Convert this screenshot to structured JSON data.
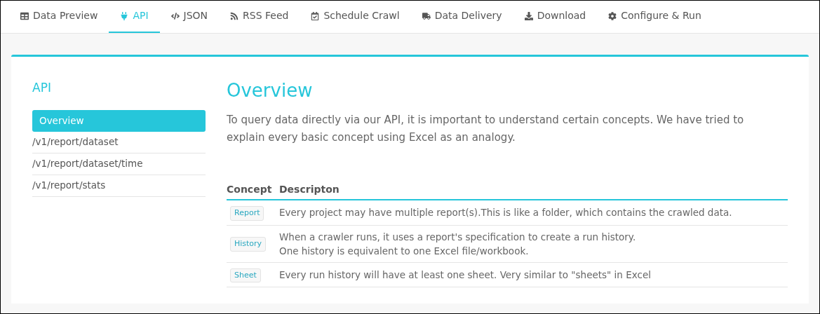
{
  "tabs": [
    {
      "label": "Data Preview",
      "selected": false
    },
    {
      "label": "API",
      "selected": true
    },
    {
      "label": "JSON",
      "selected": false
    },
    {
      "label": "RSS Feed",
      "selected": false
    },
    {
      "label": "Schedule Crawl",
      "selected": false
    },
    {
      "label": "Data Delivery",
      "selected": false
    },
    {
      "label": "Download",
      "selected": false
    },
    {
      "label": "Configure & Run",
      "selected": false
    }
  ],
  "sidebar": {
    "title": "API",
    "items": [
      {
        "label": "Overview",
        "selected": true
      },
      {
        "label": "/v1/report/dataset",
        "selected": false
      },
      {
        "label": "/v1/report/dataset/time",
        "selected": false
      },
      {
        "label": "/v1/report/stats",
        "selected": false
      }
    ]
  },
  "content": {
    "title": "Overview",
    "intro": "To query data directly via our API, it is important to understand certain concepts. We have tried to explain every basic concept using Excel as an analogy.",
    "table": {
      "columns": [
        "Concept",
        "Descripton"
      ],
      "rows": [
        {
          "concept": "Report",
          "description": [
            "Every project may have multiple report(s).This is like a folder, which contains the crawled data."
          ]
        },
        {
          "concept": "History",
          "description": [
            "When a crawler runs, it uses a report's specification to create a run history.",
            "One history is equivalent to one Excel file/workbook."
          ]
        },
        {
          "concept": "Sheet",
          "description": [
            "Every run history will have at least one sheet. Very similar to \"sheets\" in Excel"
          ]
        }
      ]
    }
  }
}
